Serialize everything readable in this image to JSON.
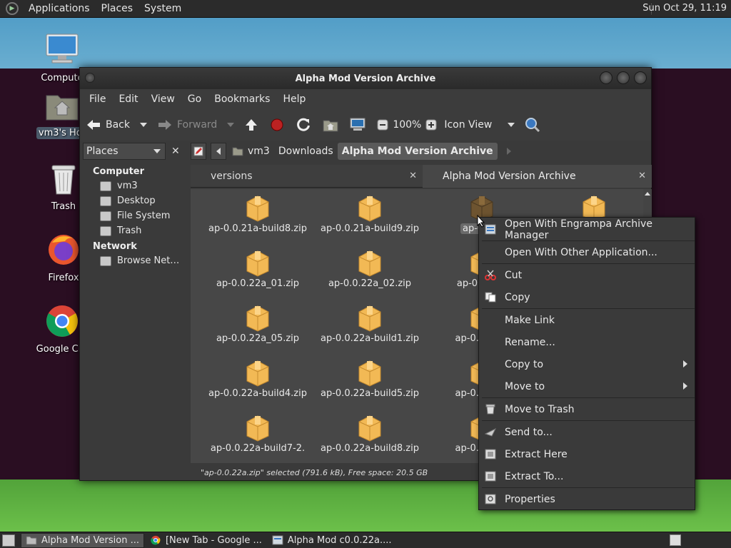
{
  "top_panel": {
    "menus": [
      "Applications",
      "Places",
      "System"
    ],
    "clock": "Sun Oct 29, 11:19"
  },
  "desktop": {
    "icons": [
      {
        "label": "Compute",
        "icon": "computer-icon"
      },
      {
        "label": "vm3's Hor",
        "icon": "home-folder-icon"
      },
      {
        "label": "Trash",
        "icon": "trash-icon"
      },
      {
        "label": "Firefox",
        "icon": "firefox-icon"
      },
      {
        "label": "Google Chr",
        "icon": "chrome-icon"
      }
    ]
  },
  "window": {
    "title": "Alpha Mod Version Archive",
    "menu": [
      "File",
      "Edit",
      "View",
      "Go",
      "Bookmarks",
      "Help"
    ],
    "toolbar": {
      "back": "Back",
      "forward": "Forward",
      "zoom": "100%",
      "view_mode": "Icon View"
    },
    "places_label": "Places",
    "sidebar": {
      "computer_head": "Computer",
      "computer_items": [
        "vm3",
        "Desktop",
        "File System",
        "Trash"
      ],
      "network_head": "Network",
      "network_items": [
        "Browse Net…"
      ]
    },
    "breadcrumbs": [
      "vm3",
      "Downloads",
      "Alpha Mod Version Archive"
    ],
    "tabs": [
      {
        "label": "versions"
      },
      {
        "label": "Alpha Mod Version Archive"
      }
    ],
    "files": [
      "ap-0.0.21a-build8.zip",
      "ap-0.0.21a-build9.zip",
      "ap-0.0.2",
      "",
      "ap-0.0.22a_01.zip",
      "ap-0.0.22a_02.zip",
      "ap-0.0.22a",
      "",
      "ap-0.0.22a_05.zip",
      "ap-0.0.22a-build1.zip",
      "ap-0.0.22a-",
      "",
      "ap-0.0.22a-build4.zip",
      "ap-0.0.22a-build5.zip",
      "ap-0.0.22a-",
      "",
      "ap-0.0.22a-build7-2.",
      "ap-0.0.22a-build8.zip",
      "ap-0.0.22a-",
      ""
    ],
    "status": "\"ap-0.0.22a.zip\" selected (791.6 kB), Free space: 20.5 GB"
  },
  "context_menu": {
    "items": [
      "Open With Engrampa Archive Manager",
      "Open With Other Application...",
      "Cut",
      "Copy",
      "Make Link",
      "Rename...",
      "Copy to",
      "Move to",
      "Move to Trash",
      "Send to...",
      "Extract Here",
      "Extract To...",
      "Properties"
    ]
  },
  "taskbar": {
    "tasks": [
      "Alpha Mod Version ...",
      "[New Tab - Google ...",
      "Alpha Mod c0.0.22a...."
    ]
  }
}
